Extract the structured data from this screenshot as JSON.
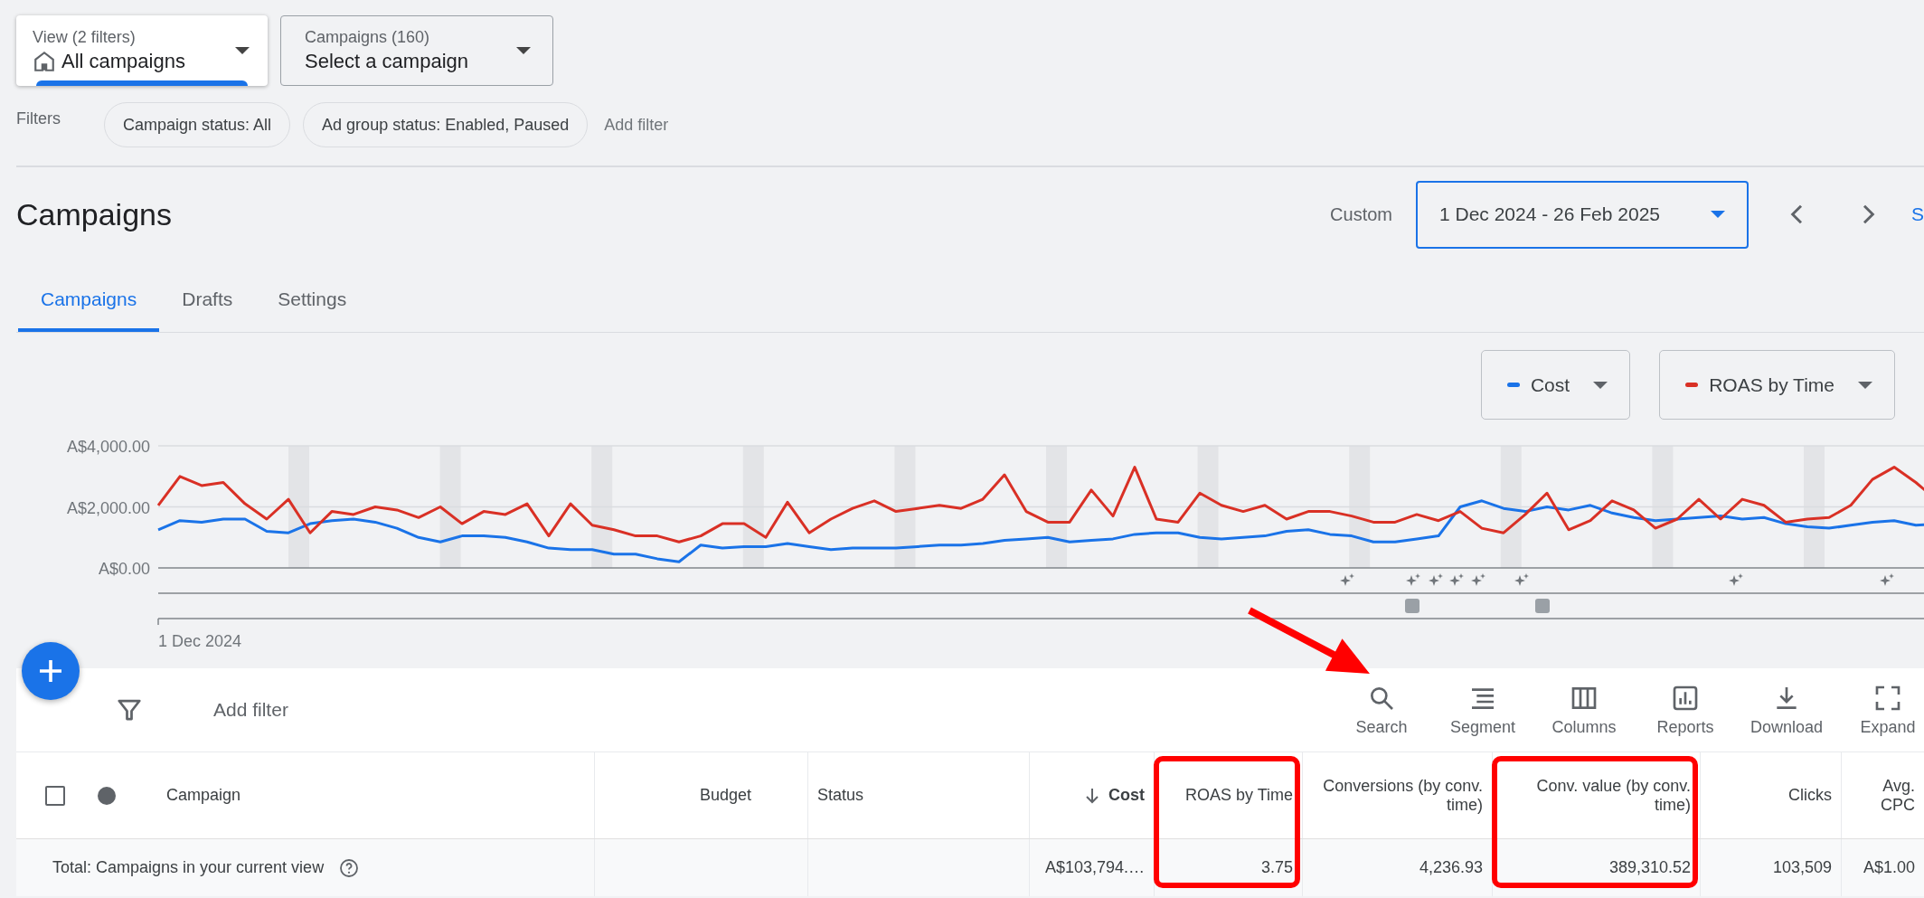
{
  "view_selector": {
    "label": "View (2 filters)",
    "value": "All campaigns"
  },
  "campaign_selector": {
    "label": "Campaigns (160)",
    "value": "Select a campaign"
  },
  "filters": {
    "label": "Filters",
    "chips": [
      "Campaign status: All",
      "Ad group status: Enabled, Paused"
    ],
    "add_filter": "Add filter"
  },
  "page_title": "Campaigns",
  "date_range": {
    "label": "Custom",
    "value": "1 Dec 2024 - 26 Feb 2025",
    "cut_link": "S"
  },
  "tabs": [
    {
      "label": "Campaigns",
      "selected": true
    },
    {
      "label": "Drafts",
      "selected": false
    },
    {
      "label": "Settings",
      "selected": false
    }
  ],
  "metric_selectors": [
    {
      "label": "Cost",
      "color": "#1a73e8"
    },
    {
      "label": "ROAS by Time",
      "color": "#d93025"
    }
  ],
  "chart": {
    "y_labels": [
      "A$4,000.00",
      "A$2,000.00",
      "A$0.00"
    ],
    "start_label": "1 Dec 2024"
  },
  "table": {
    "add_filter": "Add filter",
    "toolbar": [
      {
        "kind": "search",
        "label": "Search"
      },
      {
        "kind": "segment",
        "label": "Segment"
      },
      {
        "kind": "columns",
        "label": "Columns"
      },
      {
        "kind": "reports",
        "label": "Reports"
      },
      {
        "kind": "download",
        "label": "Download"
      },
      {
        "kind": "expand",
        "label": "Expand"
      }
    ],
    "select_all": {
      "checked": false
    },
    "columns": [
      {
        "label": "Campaign",
        "kind": "text",
        "sort_descending": false,
        "highlighted": false
      },
      {
        "label": "Budget",
        "kind": "number",
        "sort_descending": false,
        "highlighted": false
      },
      {
        "label": "Status",
        "kind": "text",
        "sort_descending": false,
        "highlighted": false
      },
      {
        "label": "Cost",
        "kind": "number",
        "sort_descending": true,
        "highlighted": false,
        "total": "A$103,794.…"
      },
      {
        "label": "ROAS by Time",
        "kind": "number",
        "sort_descending": false,
        "highlighted": true,
        "total": "3.75"
      },
      {
        "label": "Conversions (by conv. time)",
        "kind": "number",
        "sort_descending": false,
        "highlighted": false,
        "total": "4,236.93"
      },
      {
        "label": "Conv. value (by conv. time)",
        "kind": "number",
        "sort_descending": false,
        "highlighted": true,
        "total": "389,310.52"
      },
      {
        "label": "Clicks",
        "kind": "number",
        "sort_descending": false,
        "highlighted": false,
        "total": "103,509"
      },
      {
        "label": "Avg. CPC",
        "kind": "number",
        "sort_descending": false,
        "highlighted": false,
        "total": "A$1.00"
      }
    ],
    "total_row": {
      "label": "Total: Campaigns in your current view"
    }
  }
}
